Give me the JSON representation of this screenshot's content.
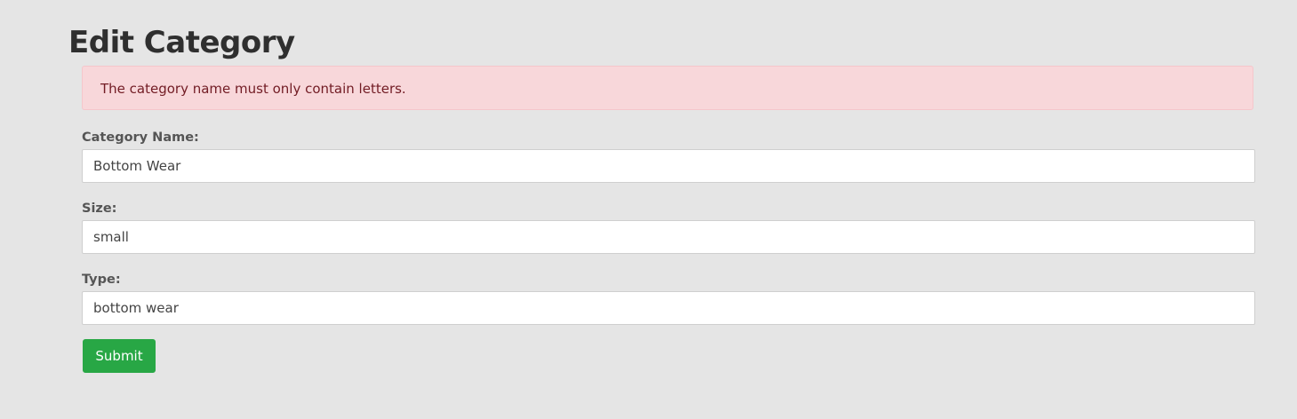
{
  "page": {
    "title": "Edit Category"
  },
  "alert": {
    "message": "The category name must only contain letters.",
    "type": "danger"
  },
  "form": {
    "category_name": {
      "label": "Category Name:",
      "value": "Bottom Wear"
    },
    "size": {
      "label": "Size:",
      "value": "small"
    },
    "type": {
      "label": "Type:",
      "value": "bottom wear"
    },
    "submit_label": "Submit"
  },
  "colors": {
    "background": "#e5e5e5",
    "alert_background": "#f8d7da",
    "alert_text": "#721c24",
    "submit_button": "#28a745"
  }
}
